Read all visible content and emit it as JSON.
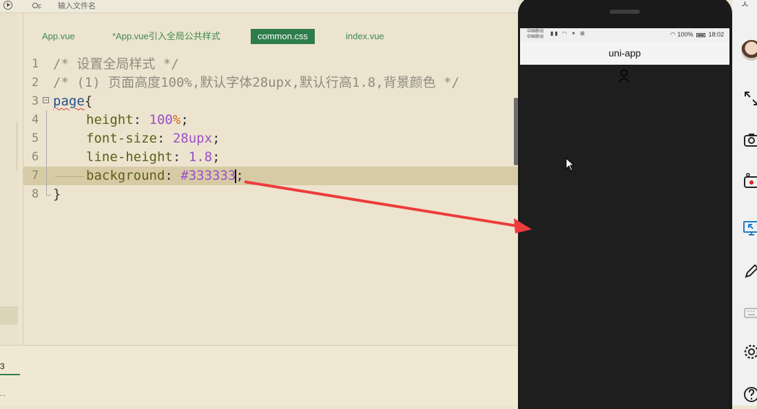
{
  "toolbar": {
    "search_shortcut": "F",
    "file_search_placeholder": "输入文件名"
  },
  "tabs": [
    {
      "label": "App.vue",
      "active": false
    },
    {
      "label": "*App.vue引入全局公共样式",
      "active": false
    },
    {
      "label": "common.css",
      "active": true
    },
    {
      "label": "index.vue",
      "active": false
    }
  ],
  "code": {
    "line_numbers": [
      "1",
      "2",
      "3",
      "4",
      "5",
      "6",
      "7",
      "8"
    ],
    "l1": "/* 设置全局样式 */",
    "l2": "/* (1) 页面高度100%,默认字体28upx,默认行高1.8,背景颜色 */",
    "l3_sel": "page",
    "l3_brace": "{",
    "l4_prop": "height",
    "l4_num": "100",
    "l4_pct": "%",
    "l5_prop": "font-size",
    "l5_val": "28upx",
    "l6_prop": "line-height",
    "l6_val": "1.8",
    "l7_prop": "background",
    "l7_val": "#333333",
    "colon": ":",
    "semi": ";",
    "l8": "}"
  },
  "console": {
    "tab_label": "3",
    "dots": ".."
  },
  "phone": {
    "carrier": "中国移动\n中国移动",
    "time": "18:02",
    "battery": "100%",
    "nav_title": "uni-app"
  },
  "right_bar": {
    "icons": [
      "avatar",
      "expand-icon",
      "camera-icon",
      "record-icon",
      "screen-cast-icon",
      "pen-icon",
      "keyboard-icon",
      "settings-icon",
      "help-icon"
    ]
  },
  "colors": {
    "accent": "#2d7d4a",
    "editor_bg": "#ece4ce",
    "phone_bg": "#1e1e1e",
    "arrow": "#ee3b3b"
  }
}
